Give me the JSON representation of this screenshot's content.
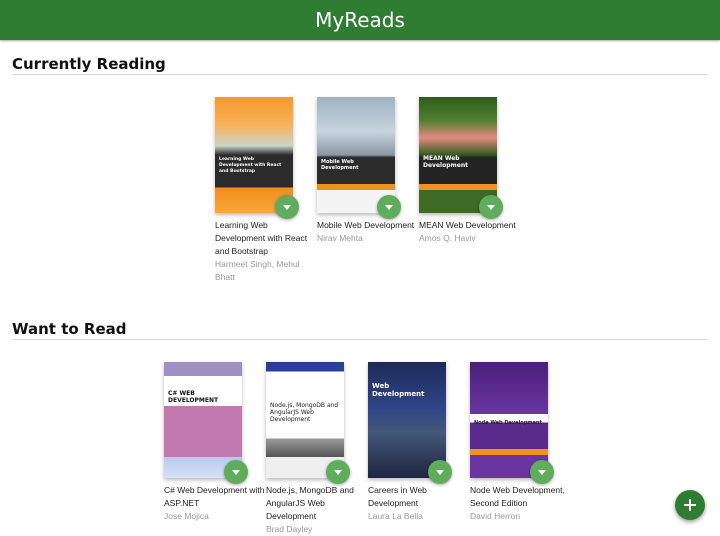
{
  "app": {
    "title": "MyReads"
  },
  "shelves": [
    {
      "title": "Currently Reading",
      "books": [
        {
          "title": "Learning Web Development with React and Bootstrap",
          "authors": "Harmeet Singh, Mehul Bhatt",
          "cover_text": "Learning Web Development with React and Bootstrap"
        },
        {
          "title": "Mobile Web Development",
          "authors": "Nirav Mehta",
          "cover_text": "Mobile Web Development"
        },
        {
          "title": "MEAN Web Development",
          "authors": "Amos Q. Haviv",
          "cover_text": "MEAN Web Development"
        }
      ]
    },
    {
      "title": "Want to Read",
      "books": [
        {
          "title": "C# Web Development with ASP.NET",
          "authors": "Jose Mojica",
          "cover_text": "C# WEB DEVELOPMENT"
        },
        {
          "title": "Node.js, MongoDB and AngularJS Web Development",
          "authors": "Brad Dayley",
          "cover_text": "Node.js, MongoDB and AngularJS Web Development"
        },
        {
          "title": "Careers in Web Development",
          "authors": "Laura La Bella",
          "cover_text": "Web Development"
        },
        {
          "title": "Node Web Development, Second Edition",
          "authors": "David Herron",
          "cover_text": "Node Web Development"
        }
      ]
    }
  ],
  "icons": {
    "shelf_changer": "triangle-down-icon",
    "add": "plus-icon"
  },
  "colors": {
    "header": "#2e7d32",
    "changer": "#60ac5d",
    "add_button": "#2e7d32"
  }
}
